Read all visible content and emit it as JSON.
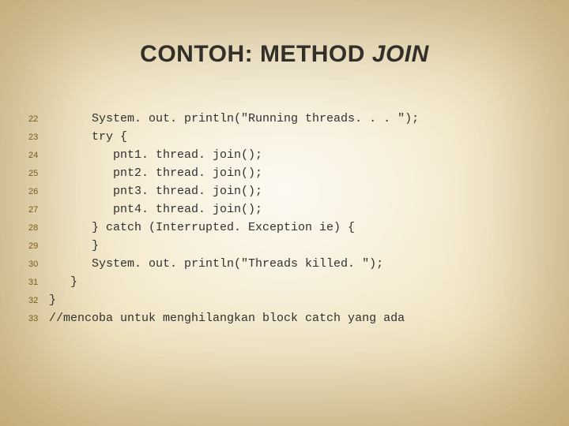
{
  "title_main": "CONTOH: METHOD ",
  "title_italic": "JOIN",
  "lines": [
    {
      "n": "22",
      "t": "      System. out. println(\"Running threads. . . \");"
    },
    {
      "n": "23",
      "t": "      try {"
    },
    {
      "n": "24",
      "t": "         pnt1. thread. join();"
    },
    {
      "n": "25",
      "t": "         pnt2. thread. join();"
    },
    {
      "n": "26",
      "t": "         pnt3. thread. join();"
    },
    {
      "n": "27",
      "t": "         pnt4. thread. join();"
    },
    {
      "n": "28",
      "t": "      } catch (Interrupted. Exception ie) {"
    },
    {
      "n": "29",
      "t": "      }"
    },
    {
      "n": "30",
      "t": "      System. out. println(\"Threads killed. \");"
    },
    {
      "n": "31",
      "t": "   }"
    },
    {
      "n": "32",
      "t": "}"
    },
    {
      "n": "33",
      "t": "//mencoba untuk menghilangkan block catch yang ada"
    }
  ]
}
